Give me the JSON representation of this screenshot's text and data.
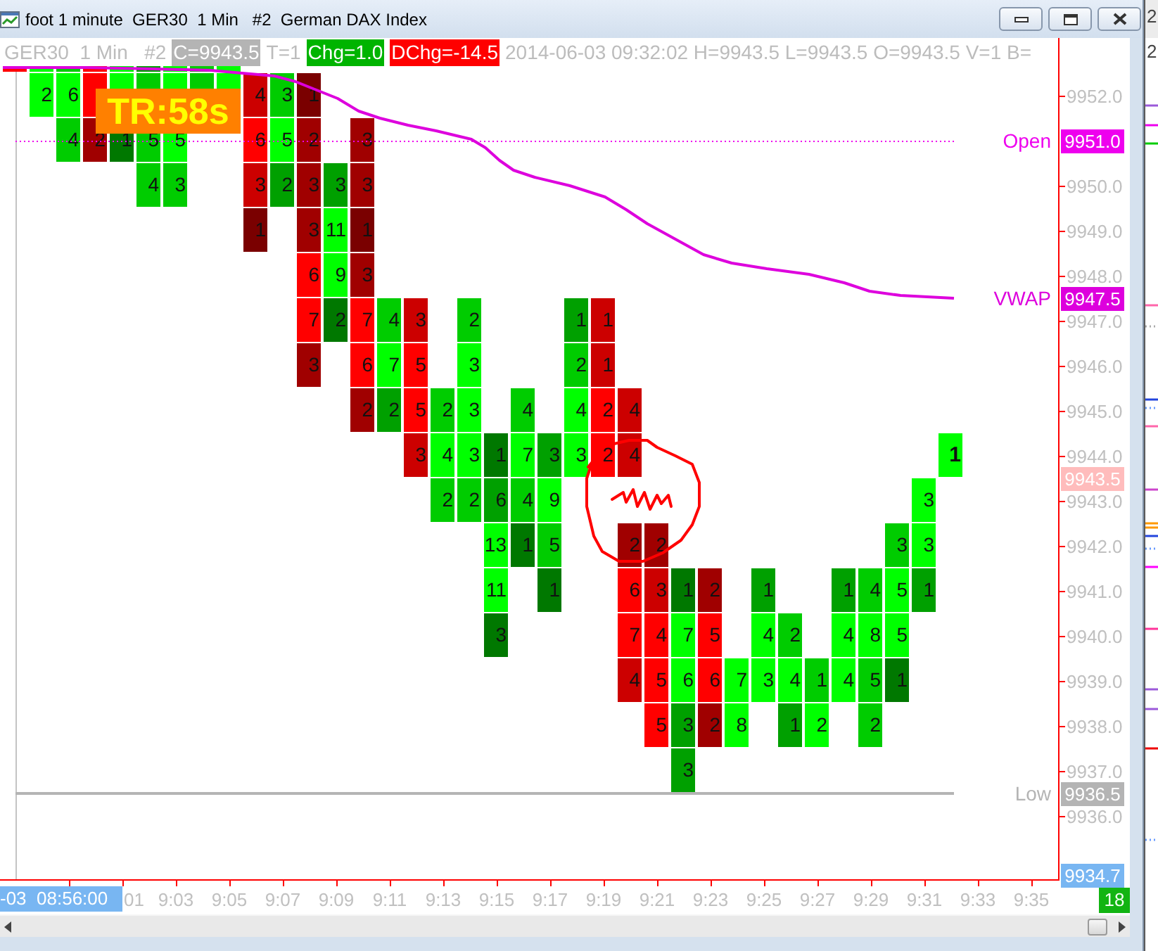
{
  "window": {
    "title": "foot 1 minute  GER30  1 Min   #2  German DAX Index"
  },
  "header": [
    {
      "kind": "text",
      "text": "GER30  1 Min   #2"
    },
    {
      "kind": "badge",
      "text": "C=9943.5",
      "color": "#b4b4b4"
    },
    {
      "kind": "text",
      "text": "T=1"
    },
    {
      "kind": "badge",
      "text": "Chg=1.0",
      "color": "#00b400"
    },
    {
      "kind": "badge",
      "text": "DChg=-14.5",
      "color": "#ff0000"
    },
    {
      "kind": "text",
      "text": "2014-06-03 09:32:02 H=9943.5 L=9943.5 O=9943.5 V=1 B="
    }
  ],
  "timer_label": "TR:58s",
  "footprint": {
    "columns": [
      {
        "live": false,
        "cells": [
          {
            "color": "#ff0000"
          }
        ]
      },
      {
        "live": false,
        "cells": [
          {
            "color": "#00ff00"
          },
          {
            "value": "2",
            "color": "#00ff00"
          }
        ]
      },
      {
        "live": false,
        "cells": [
          {
            "color": "#00cc00"
          },
          {
            "value": "6",
            "color": "#00ff00"
          },
          {
            "value": "4",
            "color": "#00cc00"
          }
        ]
      },
      {
        "live": false,
        "cells": [
          {
            "color": "#ff0000"
          },
          {
            "color": "#ff0000"
          },
          {
            "value": "2",
            "color": "#a00000"
          }
        ]
      },
      {
        "live": false,
        "cells": [
          {
            "color": "#00ff00"
          },
          {
            "color": "#00ff00"
          },
          {
            "value": "1",
            "color": "#007800"
          }
        ]
      },
      {
        "live": false,
        "cells": [
          {
            "color": "#00a000"
          },
          {
            "color": "#00cc00"
          },
          {
            "value": "5",
            "color": "#00cc00"
          },
          {
            "value": "4",
            "color": "#00cc00"
          }
        ]
      },
      {
        "live": false,
        "cells": [
          {
            "color": "#00ff00"
          },
          {
            "color": "#00ff00"
          },
          {
            "value": "5",
            "color": "#00ff00"
          },
          {
            "value": "3",
            "color": "#00cc00"
          }
        ]
      },
      {
        "live": false,
        "cells": [
          {
            "color": "#00cc00"
          },
          {
            "color": "#00cc00"
          }
        ]
      },
      {
        "live": false,
        "cells": [
          {
            "color": "#00ff00"
          },
          {
            "color": "#00ff00"
          }
        ]
      },
      {
        "live": false,
        "cells": [
          null,
          {
            "value": "4",
            "color": "#cc0000"
          },
          {
            "value": "6",
            "color": "#ff0000"
          },
          {
            "value": "3",
            "color": "#cc0000"
          },
          {
            "value": "1",
            "color": "#7a0000"
          }
        ]
      },
      {
        "live": false,
        "cells": [
          null,
          {
            "value": "3",
            "color": "#00cc00"
          },
          {
            "value": "5",
            "color": "#00ff00"
          },
          {
            "value": "2",
            "color": "#00a000"
          }
        ]
      },
      {
        "live": false,
        "cells": [
          null,
          {
            "value": "1",
            "color": "#7a0000"
          },
          {
            "value": "2",
            "color": "#a00000"
          },
          {
            "value": "3",
            "color": "#a00000"
          },
          {
            "value": "3",
            "color": "#a00000"
          },
          {
            "value": "6",
            "color": "#ff0000"
          },
          {
            "value": "7",
            "color": "#ff0000"
          },
          {
            "value": "3",
            "color": "#a00000"
          }
        ]
      },
      {
        "live": false,
        "cells": [
          null,
          null,
          null,
          {
            "value": "3",
            "color": "#00a000"
          },
          {
            "value": "11",
            "color": "#00ff00"
          },
          {
            "value": "9",
            "color": "#00ff00"
          },
          {
            "value": "2",
            "color": "#007800"
          }
        ]
      },
      {
        "live": false,
        "cells": [
          null,
          null,
          {
            "value": "3",
            "color": "#a00000"
          },
          {
            "value": "3",
            "color": "#a00000"
          },
          {
            "value": "1",
            "color": "#7a0000"
          },
          {
            "value": "3",
            "color": "#a00000"
          },
          {
            "value": "7",
            "color": "#ff0000"
          },
          {
            "value": "6",
            "color": "#ff0000"
          },
          {
            "value": "2",
            "color": "#a00000"
          }
        ]
      },
      {
        "live": false,
        "cells": [
          null,
          null,
          null,
          null,
          null,
          null,
          {
            "value": "4",
            "color": "#00cc00"
          },
          {
            "value": "7",
            "color": "#00ff00"
          },
          {
            "value": "2",
            "color": "#00a000"
          }
        ]
      },
      {
        "live": false,
        "cells": [
          null,
          null,
          null,
          null,
          null,
          null,
          {
            "value": "3",
            "color": "#cc0000"
          },
          {
            "value": "5",
            "color": "#ff0000"
          },
          {
            "value": "5",
            "color": "#ff0000"
          },
          {
            "value": "3",
            "color": "#cc0000"
          }
        ]
      },
      {
        "live": false,
        "cells": [
          null,
          null,
          null,
          null,
          null,
          null,
          null,
          null,
          {
            "value": "2",
            "color": "#00cc00"
          },
          {
            "value": "4",
            "color": "#00ff00"
          },
          {
            "value": "2",
            "color": "#00cc00"
          }
        ]
      },
      {
        "live": false,
        "cells": [
          null,
          null,
          null,
          null,
          null,
          null,
          {
            "value": "2",
            "color": "#00cc00"
          },
          {
            "value": "3",
            "color": "#00ff00"
          },
          {
            "value": "3",
            "color": "#00ff00"
          },
          {
            "value": "3",
            "color": "#00ff00"
          },
          {
            "value": "2",
            "color": "#00cc00"
          }
        ]
      },
      {
        "live": false,
        "cells": [
          null,
          null,
          null,
          null,
          null,
          null,
          null,
          null,
          null,
          {
            "value": "1",
            "color": "#007800"
          },
          {
            "value": "6",
            "color": "#00a000"
          },
          {
            "value": "13",
            "color": "#00ff00"
          },
          {
            "value": "11",
            "color": "#00ff00"
          },
          {
            "value": "3",
            "color": "#007800"
          }
        ]
      },
      {
        "live": false,
        "cells": [
          null,
          null,
          null,
          null,
          null,
          null,
          null,
          null,
          {
            "value": "4",
            "color": "#00cc00"
          },
          {
            "value": "7",
            "color": "#00ff00"
          },
          {
            "value": "4",
            "color": "#00cc00"
          },
          {
            "value": "1",
            "color": "#007800"
          }
        ]
      },
      {
        "live": false,
        "cells": [
          null,
          null,
          null,
          null,
          null,
          null,
          null,
          null,
          null,
          {
            "value": "3",
            "color": "#00a000"
          },
          {
            "value": "9",
            "color": "#00ff00"
          },
          {
            "value": "5",
            "color": "#00cc00"
          },
          {
            "value": "1",
            "color": "#007800"
          }
        ]
      },
      {
        "live": false,
        "cells": [
          null,
          null,
          null,
          null,
          null,
          null,
          {
            "value": "1",
            "color": "#00a000"
          },
          {
            "value": "2",
            "color": "#00cc00"
          },
          {
            "value": "4",
            "color": "#00ff00"
          },
          {
            "value": "3",
            "color": "#00ff00"
          }
        ]
      },
      {
        "live": false,
        "cells": [
          null,
          null,
          null,
          null,
          null,
          null,
          {
            "value": "1",
            "color": "#cc0000"
          },
          {
            "value": "1",
            "color": "#cc0000"
          },
          {
            "value": "2",
            "color": "#ff0000"
          },
          {
            "value": "2",
            "color": "#ff0000"
          }
        ]
      },
      {
        "live": false,
        "cells": [
          null,
          null,
          null,
          null,
          null,
          null,
          null,
          null,
          {
            "value": "4",
            "color": "#cc0000"
          },
          {
            "value": "4",
            "color": "#cc0000"
          },
          null,
          {
            "value": "2",
            "color": "#a00000"
          },
          {
            "value": "6",
            "color": "#ff0000"
          },
          {
            "value": "7",
            "color": "#ff0000"
          },
          {
            "value": "4",
            "color": "#cc0000"
          }
        ]
      },
      {
        "live": false,
        "cells": [
          null,
          null,
          null,
          null,
          null,
          null,
          null,
          null,
          null,
          null,
          null,
          {
            "value": "2",
            "color": "#a00000"
          },
          {
            "value": "3",
            "color": "#cc0000"
          },
          {
            "value": "4",
            "color": "#ff0000"
          },
          {
            "value": "5",
            "color": "#ff0000"
          },
          {
            "value": "5",
            "color": "#ff0000"
          }
        ]
      },
      {
        "live": false,
        "cells": [
          null,
          null,
          null,
          null,
          null,
          null,
          null,
          null,
          null,
          null,
          null,
          null,
          {
            "value": "1",
            "color": "#007800"
          },
          {
            "value": "7",
            "color": "#00ff00"
          },
          {
            "value": "6",
            "color": "#00ff00"
          },
          {
            "value": "3",
            "color": "#00a000"
          },
          {
            "value": "3",
            "color": "#00a000"
          }
        ]
      },
      {
        "live": false,
        "cells": [
          null,
          null,
          null,
          null,
          null,
          null,
          null,
          null,
          null,
          null,
          null,
          null,
          {
            "value": "2",
            "color": "#a00000"
          },
          {
            "value": "5",
            "color": "#ff0000"
          },
          {
            "value": "6",
            "color": "#ff0000"
          },
          {
            "value": "2",
            "color": "#a00000"
          }
        ]
      },
      {
        "live": false,
        "cells": [
          null,
          null,
          null,
          null,
          null,
          null,
          null,
          null,
          null,
          null,
          null,
          null,
          null,
          null,
          {
            "value": "7",
            "color": "#00ff00"
          },
          {
            "value": "8",
            "color": "#00ff00"
          }
        ]
      },
      {
        "live": false,
        "cells": [
          null,
          null,
          null,
          null,
          null,
          null,
          null,
          null,
          null,
          null,
          null,
          null,
          {
            "value": "1",
            "color": "#00a000"
          },
          {
            "value": "4",
            "color": "#00ff00"
          },
          {
            "value": "3",
            "color": "#00ff00"
          }
        ]
      },
      {
        "live": false,
        "cells": [
          null,
          null,
          null,
          null,
          null,
          null,
          null,
          null,
          null,
          null,
          null,
          null,
          null,
          {
            "value": "2",
            "color": "#00cc00"
          },
          {
            "value": "4",
            "color": "#00ff00"
          },
          {
            "value": "1",
            "color": "#00a000"
          }
        ]
      },
      {
        "live": false,
        "cells": [
          null,
          null,
          null,
          null,
          null,
          null,
          null,
          null,
          null,
          null,
          null,
          null,
          null,
          null,
          {
            "value": "1",
            "color": "#00cc00"
          },
          {
            "value": "2",
            "color": "#00ff00"
          }
        ]
      },
      {
        "live": false,
        "cells": [
          null,
          null,
          null,
          null,
          null,
          null,
          null,
          null,
          null,
          null,
          null,
          null,
          {
            "value": "1",
            "color": "#00a000"
          },
          {
            "value": "4",
            "color": "#00ff00"
          },
          {
            "value": "4",
            "color": "#00ff00"
          }
        ]
      },
      {
        "live": false,
        "cells": [
          null,
          null,
          null,
          null,
          null,
          null,
          null,
          null,
          null,
          null,
          null,
          null,
          {
            "value": "4",
            "color": "#00cc00"
          },
          {
            "value": "8",
            "color": "#00ff00"
          },
          {
            "value": "5",
            "color": "#00cc00"
          },
          {
            "value": "2",
            "color": "#00cc00"
          }
        ]
      },
      {
        "live": false,
        "cells": [
          null,
          null,
          null,
          null,
          null,
          null,
          null,
          null,
          null,
          null,
          null,
          {
            "value": "3",
            "color": "#00cc00"
          },
          {
            "value": "5",
            "color": "#00ff00"
          },
          {
            "value": "5",
            "color": "#00ff00"
          },
          {
            "value": "1",
            "color": "#007800"
          }
        ]
      },
      {
        "live": false,
        "cells": [
          null,
          null,
          null,
          null,
          null,
          null,
          null,
          null,
          null,
          null,
          {
            "value": "3",
            "color": "#00ff00"
          },
          {
            "value": "3",
            "color": "#00ff00"
          },
          {
            "value": "1",
            "color": "#00a000"
          }
        ]
      },
      {
        "live": true,
        "cells": [
          null,
          null,
          null,
          null,
          null,
          null,
          null,
          null,
          null,
          {
            "value": "1",
            "color": "#00ff00"
          }
        ]
      }
    ]
  },
  "price_axis": {
    "ticks": [
      "9952.0",
      "9950.0",
      "9949.0",
      "9948.0",
      "9947.0",
      "9946.0",
      "9945.0",
      "9944.0",
      "9943.0",
      "9942.0",
      "9941.0",
      "9940.0",
      "9939.0",
      "9938.0",
      "9937.0",
      "9936.0"
    ]
  },
  "price_markers": [
    {
      "kind": "open",
      "label": "Open",
      "price": "9951.0",
      "color": "#ee00ee"
    },
    {
      "kind": "vwap",
      "label": "VWAP",
      "price": "9947.5",
      "color": "#dd00dd"
    },
    {
      "kind": "last",
      "price": "9943.5",
      "color": "#ffbcbc"
    },
    {
      "kind": "low",
      "label": "Low",
      "price": "9936.5",
      "color": "#b4b4b4"
    },
    {
      "kind": "cursor",
      "price": "9934.7",
      "color": "#78b6f2"
    }
  ],
  "time_axis": {
    "cursor_label": "-03  08:56:00",
    "labels": [
      "01",
      "9:03",
      "9:05",
      "9:07",
      "9:09",
      "9:11",
      "9:13",
      "9:15",
      "9:17",
      "9:19",
      "9:21",
      "9:23",
      "9:25",
      "9:27",
      "9:29",
      "9:31",
      "9:33",
      "9:35"
    ]
  },
  "count_badge": "18",
  "background_window": {
    "texts": [
      "2",
      "2"
    ]
  }
}
